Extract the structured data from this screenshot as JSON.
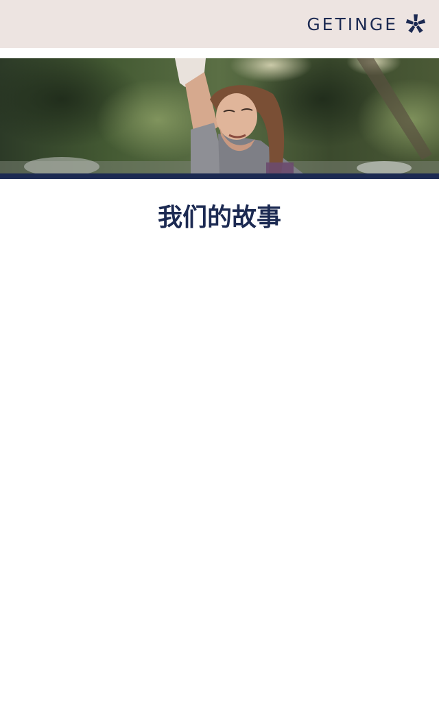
{
  "header": {
    "brand_name": "GETINGE",
    "logo_icon": "getinge-star-icon",
    "background_color": "#ede4e1",
    "brand_color": "#1c2a52"
  },
  "hero": {
    "image": "girl-reaching-up-outdoors-photo",
    "rule_color": "#1c2a52"
  },
  "main": {
    "title": "我们的故事"
  }
}
